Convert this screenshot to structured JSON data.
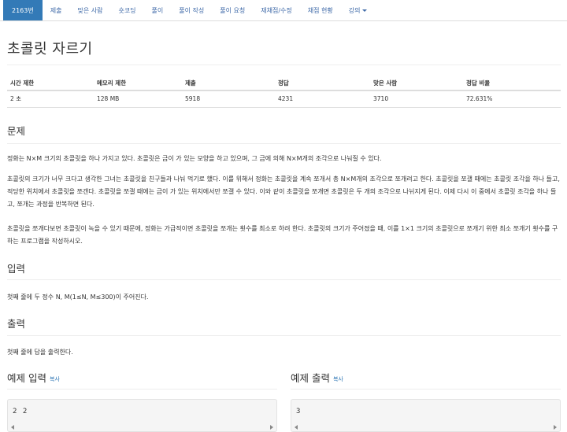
{
  "nav": {
    "items": [
      {
        "label": "2163번",
        "active": true
      },
      {
        "label": "제출"
      },
      {
        "label": "맞은 사람"
      },
      {
        "label": "숏코딩"
      },
      {
        "label": "풀이"
      },
      {
        "label": "풀이 작성"
      },
      {
        "label": "풀이 요청"
      },
      {
        "label": "재채점/수정"
      },
      {
        "label": "채점 현황"
      },
      {
        "label": "강의"
      }
    ]
  },
  "problem": {
    "title": "초콜릿 자르기",
    "headers": [
      "시간 제한",
      "메모리 제한",
      "제출",
      "정답",
      "맞은 사람",
      "정답 비율"
    ],
    "values": [
      "2 초",
      "128 MB",
      "5918",
      "4231",
      "3710",
      "72.631%"
    ]
  },
  "sections": {
    "description_title": "문제",
    "description": [
      "정화는 N×M 크기의 초콜릿을 하나 가지고 있다. 초콜릿은 금이 가 있는 모양을 하고 있으며, 그 금에 의해 N×M개의 조각으로 나눠질 수 있다.",
      "초콜릿의 크기가 너무 크다고 생각한 그녀는 초콜릿을 친구들과 나눠 먹기로 했다. 이를 위해서 정화는 초콜릿을 계속 쪼개서 총 N×M개의 조각으로 쪼개려고 한다. 초콜릿을 쪼갤 때에는 초콜릿 조각을 하나 들고, 적당한 위치에서 초콜릿을 쪼갠다. 초콜릿을 쪼갤 때에는 금이 가 있는 위치에서만 쪼갤 수 있다. 이와 같이 초콜릿을 쪼개면 초콜릿은 두 개의 조각으로 나뉘지게 된다. 이제 다시 이 중에서 초콜릿 조각을 하나 들고, 쪼개는 과정을 반복하면 된다.",
      "초콜릿을 쪼개다보면 초콜릿이 녹을 수 있기 때문에, 정화는 가급적이면 초콜릿을 쪼개는 횟수를 최소로 하려 한다. 초콜릿의 크기가 주어졌을 때, 이를 1×1 크기의 초콜릿으로 쪼개기 위한 최소 쪼개기 횟수를 구하는 프로그램을 작성하시오."
    ],
    "input_title": "입력",
    "input": "첫째 줄에 두 정수 N, M(1≤N, M≤300)이 주어진다.",
    "output_title": "출력",
    "output": "첫째 줄에 답을 출력한다."
  },
  "samples": {
    "input_title": "예제 입력",
    "output_title": "예제 출력",
    "copy_label": "복사",
    "input_value": "2 2",
    "output_value": "3"
  },
  "colors": {
    "accent": "#337ab7"
  }
}
